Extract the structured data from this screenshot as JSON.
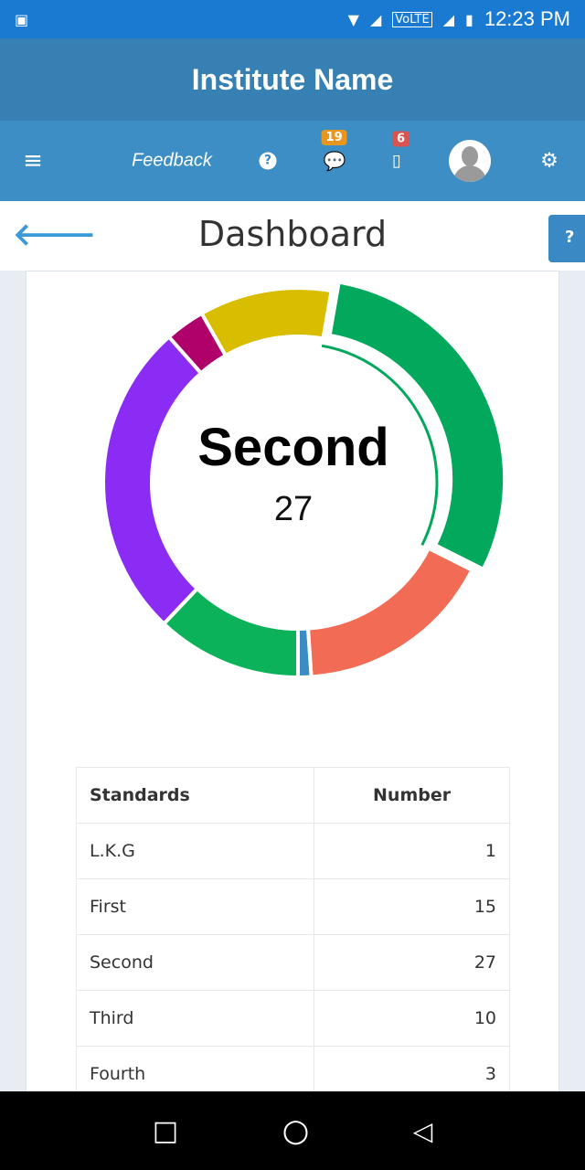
{
  "status_bar": {
    "time": "12:23 PM",
    "network": "VoLTE"
  },
  "app": {
    "title": "Institute Name"
  },
  "nav": {
    "feedback": "Feedback",
    "messages_badge": "19",
    "mobile_badge": "6",
    "badge_colors": {
      "messages": "#e8961e",
      "mobile": "#d9534f"
    }
  },
  "page": {
    "title": "Dashboard"
  },
  "chart_data": {
    "type": "doughnut",
    "center_label": "Second",
    "center_value": "27",
    "highlighted": "Second",
    "categories": [
      "L.K.G",
      "First",
      "Second",
      "Third",
      "Fourth",
      "",
      ""
    ],
    "values": [
      1,
      15,
      27,
      10,
      3,
      24,
      11
    ],
    "colors": [
      "#3a8cc4",
      "#f26b55",
      "#02a85c",
      "#d9bd00",
      "#b0006a",
      "#8b2cf5",
      "#0bb25a"
    ]
  },
  "table": {
    "headers": [
      "Standards",
      "Number"
    ],
    "rows": [
      [
        "L.K.G",
        "1"
      ],
      [
        "First",
        "15"
      ],
      [
        "Second",
        "27"
      ],
      [
        "Third",
        "10"
      ],
      [
        "Fourth",
        "3"
      ]
    ]
  }
}
